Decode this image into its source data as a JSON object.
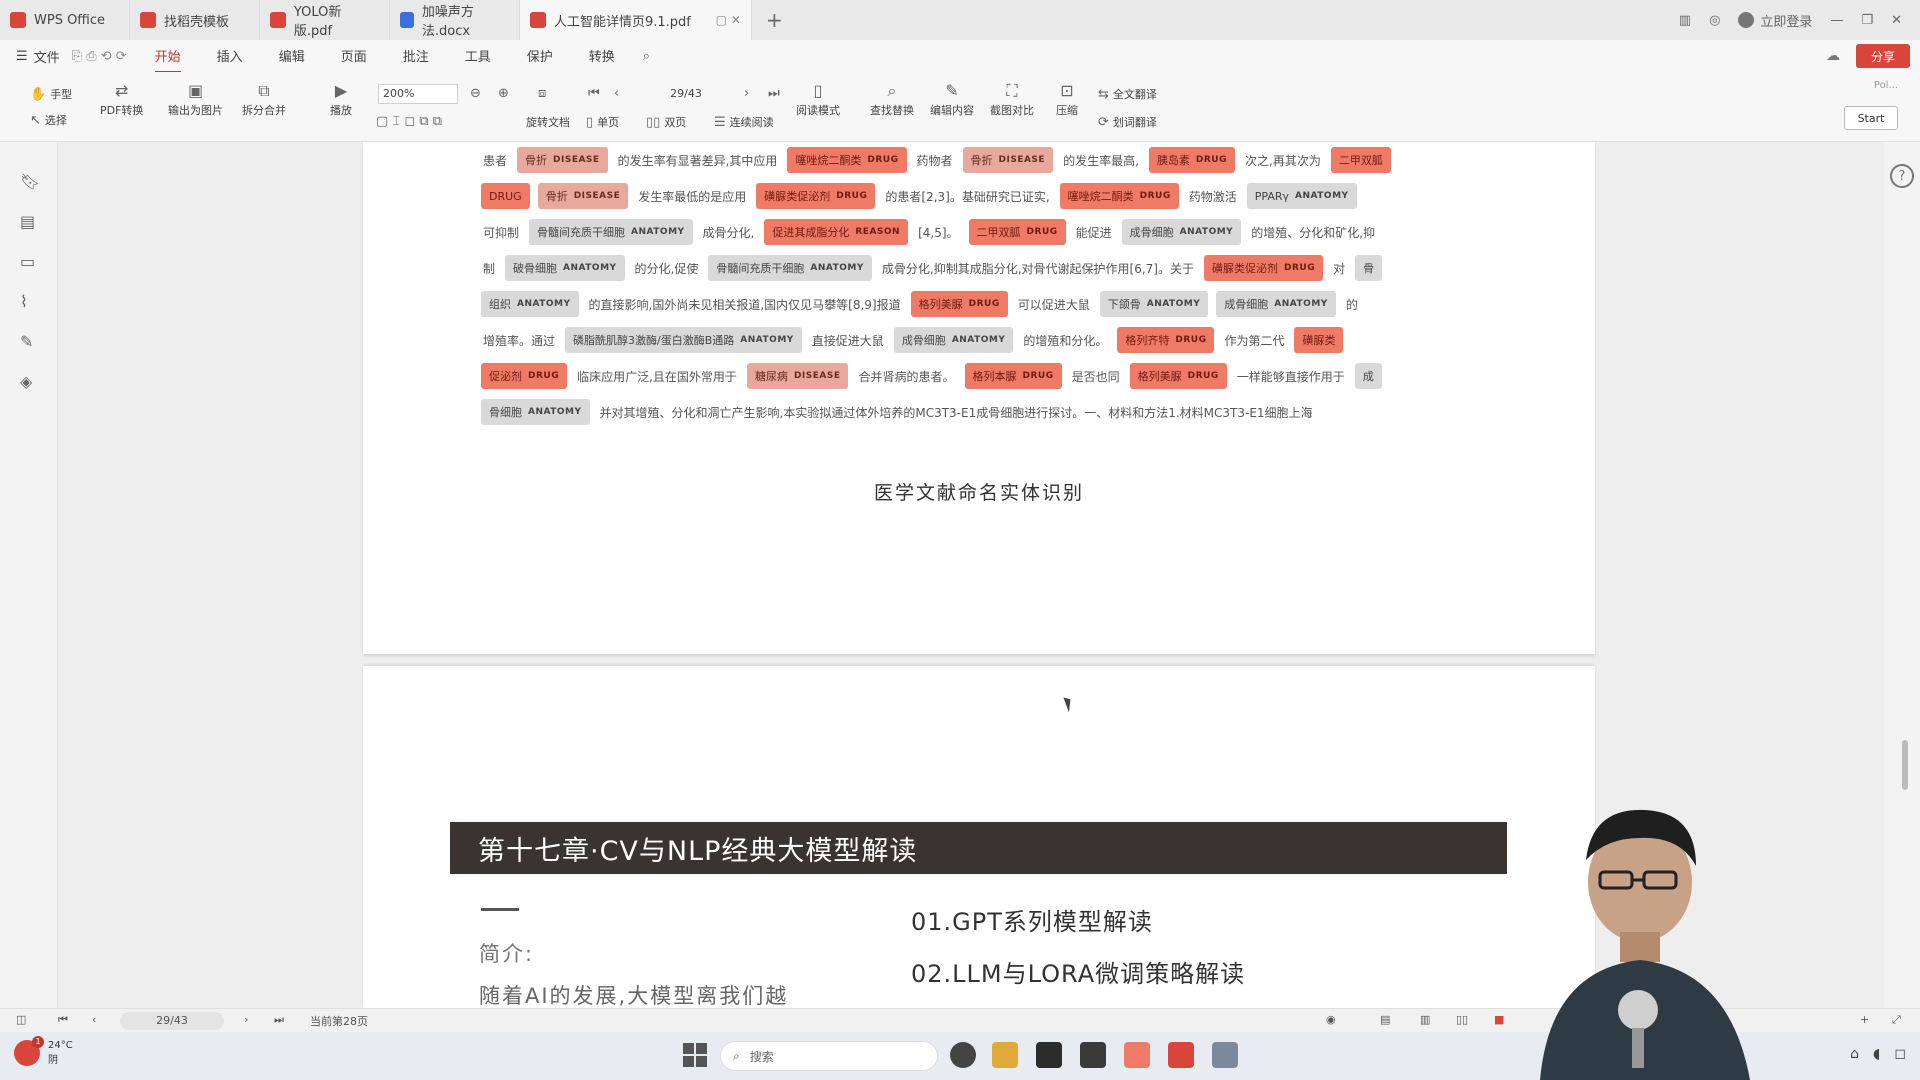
{
  "tabs": [
    {
      "label": "WPS Office",
      "color": "#d9453b",
      "active": false
    },
    {
      "label": "找稻壳模板",
      "color": "#d9453b",
      "active": false
    },
    {
      "label": "YOLO新版.pdf",
      "color": "#d9453b",
      "active": false
    },
    {
      "label": "加噪声方法.docx",
      "color": "#3b6fd9",
      "active": false
    },
    {
      "label": "人工智能详情页9.1.pdf",
      "color": "#d9453b",
      "active": true
    }
  ],
  "titlebar": {
    "login": "立即登录"
  },
  "menu": {
    "file": "文件",
    "items": [
      "开始",
      "插入",
      "编辑",
      "页面",
      "批注",
      "工具",
      "保护",
      "转换"
    ],
    "active": "开始",
    "share": "分享"
  },
  "ribbon": {
    "hand": "手型",
    "select": "选择",
    "pdf_convert": "PDF转换",
    "export_img": "输出为图片",
    "split_merge": "拆分合并",
    "play": "播放",
    "zoom": "200%",
    "page": "29/43",
    "rotate": "旋转文档",
    "single": "单页",
    "double": "双页",
    "continuous": "连续阅读",
    "read_mode": "阅读模式",
    "find_replace": "查找替换",
    "edit_content": "编辑内容",
    "compare": "截图对比",
    "compress": "压缩",
    "translate_full": "全文翻译",
    "translate_word": "划词翻译",
    "pdf_mini": "Pol...",
    "start": "Start"
  },
  "doc": {
    "ner_lines": [
      [
        {
          "t": "患者"
        },
        {
          "e": "骨折",
          "l": "DISEASE",
          "k": "disease"
        },
        {
          "t": "的发生率有显著差异,其中应用"
        },
        {
          "e": "噻唑烷二酮类",
          "l": "DRUG",
          "k": "drug"
        },
        {
          "t": "药物者"
        },
        {
          "e": "骨折",
          "l": "DISEASE",
          "k": "disease"
        },
        {
          "t": "的发生率最高,"
        },
        {
          "e": "胰岛素",
          "l": "DRUG",
          "k": "drug"
        },
        {
          "t": "次之,再其次为"
        },
        {
          "e": "二甲双胍",
          "l": "",
          "k": "drug"
        }
      ],
      [
        {
          "e": "DRUG",
          "l": "",
          "k": "drug"
        },
        {
          "e": "骨折",
          "l": "DISEASE",
          "k": "disease"
        },
        {
          "t": "发生率最低的是应用"
        },
        {
          "e": "磺脲类促泌剂",
          "l": "DRUG",
          "k": "drug"
        },
        {
          "t": "的患者[2,3]。基础研究已证实,"
        },
        {
          "e": "噻唑烷二酮类",
          "l": "DRUG",
          "k": "drug"
        },
        {
          "t": "药物激活"
        },
        {
          "e": "PPARγ",
          "l": "ANATOMY",
          "k": "anatomy"
        }
      ],
      [
        {
          "t": "可抑制"
        },
        {
          "e": "骨髓间充质干细胞",
          "l": "ANATOMY",
          "k": "anatomy"
        },
        {
          "t": "成骨分化,"
        },
        {
          "e": "促进其成脂分化",
          "l": "REASON",
          "k": "reason"
        },
        {
          "t": "[4,5]。"
        },
        {
          "e": "二甲双胍",
          "l": "DRUG",
          "k": "drug"
        },
        {
          "t": "能促进"
        },
        {
          "e": "成骨细胞",
          "l": "ANATOMY",
          "k": "anatomy"
        },
        {
          "t": "的增殖、分化和矿化,抑"
        }
      ],
      [
        {
          "t": "制"
        },
        {
          "e": "破骨细胞",
          "l": "ANATOMY",
          "k": "anatomy"
        },
        {
          "t": "的分化,促使"
        },
        {
          "e": "骨髓间充质干细胞",
          "l": "ANATOMY",
          "k": "anatomy"
        },
        {
          "t": "成骨分化,抑制其成脂分化,对骨代谢起保护作用[6,7]。关于"
        },
        {
          "e": "磺脲类促泌剂",
          "l": "DRUG",
          "k": "drug"
        },
        {
          "t": "对"
        },
        {
          "e": "骨",
          "l": "",
          "k": "anatomy"
        }
      ],
      [
        {
          "e": "组织",
          "l": "ANATOMY",
          "k": "anatomy"
        },
        {
          "t": "的直接影响,国外尚未见相关报道,国内仅见马攀等[8,9]报道"
        },
        {
          "e": "格列美脲",
          "l": "DRUG",
          "k": "drug"
        },
        {
          "t": "可以促进大鼠"
        },
        {
          "e": "下颌骨",
          "l": "ANATOMY",
          "k": "anatomy"
        },
        {
          "e": "成骨细胞",
          "l": "ANATOMY",
          "k": "anatomy"
        },
        {
          "t": "的"
        }
      ],
      [
        {
          "t": "增殖率。通过"
        },
        {
          "e": "磷脂酰肌醇3激酶/蛋白激酶B通路",
          "l": "ANATOMY",
          "k": "anatomy"
        },
        {
          "t": "直接促进大鼠"
        },
        {
          "e": "成骨细胞",
          "l": "ANATOMY",
          "k": "anatomy"
        },
        {
          "t": "的增殖和分化。"
        },
        {
          "e": "格列齐特",
          "l": "DRUG",
          "k": "drug"
        },
        {
          "t": "作为第二代"
        },
        {
          "e": "磺脲类",
          "l": "",
          "k": "drug"
        }
      ],
      [
        {
          "e": "促泌剂",
          "l": "DRUG",
          "k": "drug"
        },
        {
          "t": "临床应用广泛,且在国外常用于"
        },
        {
          "e": "糖尿病",
          "l": "DISEASE",
          "k": "disease"
        },
        {
          "t": "合并肾病的患者。"
        },
        {
          "e": "格列本脲",
          "l": "DRUG",
          "k": "drug"
        },
        {
          "t": "是否也同"
        },
        {
          "e": "格列美脲",
          "l": "DRUG",
          "k": "drug"
        },
        {
          "t": "一样能够直接作用于"
        },
        {
          "e": "成",
          "l": "",
          "k": "anatomy"
        }
      ],
      [
        {
          "e": "骨细胞",
          "l": "ANATOMY",
          "k": "anatomy"
        },
        {
          "t": "并对其增殖、分化和凋亡产生影响,本实验拟通过体外培养的MC3T3-E1成骨细胞进行探讨。一、材料和方法1.材料MC3T3-E1细胞上海"
        }
      ]
    ],
    "caption": "医学文献命名实体识别",
    "chapter": "第十七章·CV与NLP经典大模型解读",
    "intro_label": "简介:",
    "intro_body": "随着AI的发展,大模型离我们越",
    "toc": [
      "01.GPT系列模型解读",
      "02.LLM与LORA微调策略解读"
    ]
  },
  "status": {
    "page": "29/43",
    "page_label": "当前第28页"
  },
  "taskbar": {
    "temp": "24°C",
    "weather": "阴",
    "search": "搜索"
  },
  "colors": {
    "accent": "#c0392b",
    "drug": "#ef7a66",
    "disease": "#e8a89c",
    "anatomy": "#d9d9d9",
    "chapter_bg": "#3b3330"
  }
}
